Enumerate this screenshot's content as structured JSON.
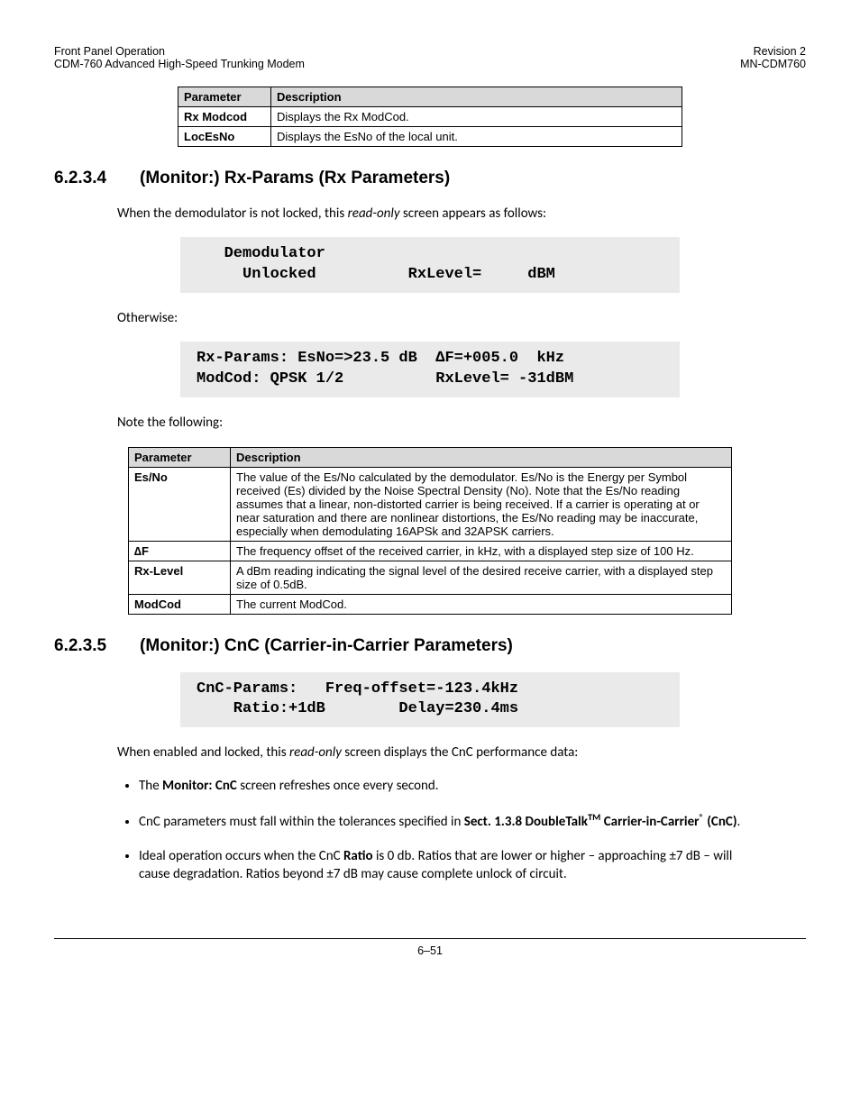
{
  "header": {
    "left1": "Front Panel Operation",
    "left2": "CDM-760 Advanced High-Speed Trunking Modem",
    "right1": "Revision 2",
    "right2": "MN-CDM760"
  },
  "table1": {
    "h1": "Parameter",
    "h2": "Description",
    "rows": [
      {
        "p": "Rx Modcod",
        "d": "Displays the Rx ModCod."
      },
      {
        "p": "LocEsNo",
        "d": "Displays the EsNo of the local unit."
      }
    ]
  },
  "sec1": {
    "num": "6.2.3.4",
    "title": "(Monitor:) Rx-Params (Rx Parameters)",
    "p1a": "When the demodulator is not locked, this ",
    "p1b": "read-only",
    "p1c": " screen appears as follows:",
    "display1": "   Demodulator\n     Unlocked          RxLevel=     dBM",
    "p2": "Otherwise:",
    "display2": "Rx-Params: EsNo=>23.5 dB  ∆F=+005.0  kHz\nModCod: QPSK 1/2          RxLevel= -31dBM",
    "p3": "Note the following:"
  },
  "table2": {
    "h1": "Parameter",
    "h2": "Description",
    "rows": [
      {
        "p": "Es/No",
        "d": "The value of the Es/No calculated by the demodulator. Es/No is the Energy per Symbol received (Es) divided by the Noise Spectral Density (No). Note that the Es/No reading assumes that a linear, non-distorted carrier is being received. If a carrier is operating at or near saturation and there are nonlinear distortions, the Es/No reading may be inaccurate, especially when demodulating 16APSk and 32APSK carriers."
      },
      {
        "p": "∆F",
        "d": "The frequency offset of the received carrier, in kHz, with a displayed step size of 100 Hz."
      },
      {
        "p": "Rx-Level",
        "d": "A dBm reading indicating the signal level of the desired receive carrier, with a displayed step size of 0.5dB."
      },
      {
        "p": "ModCod",
        "d": "The current ModCod."
      }
    ]
  },
  "sec2": {
    "num": "6.2.3.5",
    "title": "(Monitor:) CnC (Carrier-in-Carrier Parameters)",
    "display": "CnC-Params:   Freq-offset=-123.4kHz\n    Ratio:+1dB        Delay=230.4ms",
    "p1a": "When enabled and locked, this ",
    "p1b": "read-only",
    "p1c": " screen displays the CnC performance data:",
    "b1a": "The ",
    "b1b": "Monitor: CnC",
    "b1c": " screen refreshes once every second.",
    "b2a": "CnC parameters must fall within the tolerances specified in ",
    "b2b": "Sect. 1.3.8 DoubleTalk",
    "b2tm": "TM",
    "b2c": " Carrier-in-Carrier",
    "b2r": "®",
    "b2d": " (CnC)",
    "b2e": ".",
    "b3a": "Ideal operation occurs when the CnC ",
    "b3b": "Ratio",
    "b3c": " is 0 db. Ratios that are lower or higher – approaching ±7 dB – will cause degradation. Ratios beyond ±7 dB may cause complete unlock of circuit."
  },
  "footer": "6–51"
}
